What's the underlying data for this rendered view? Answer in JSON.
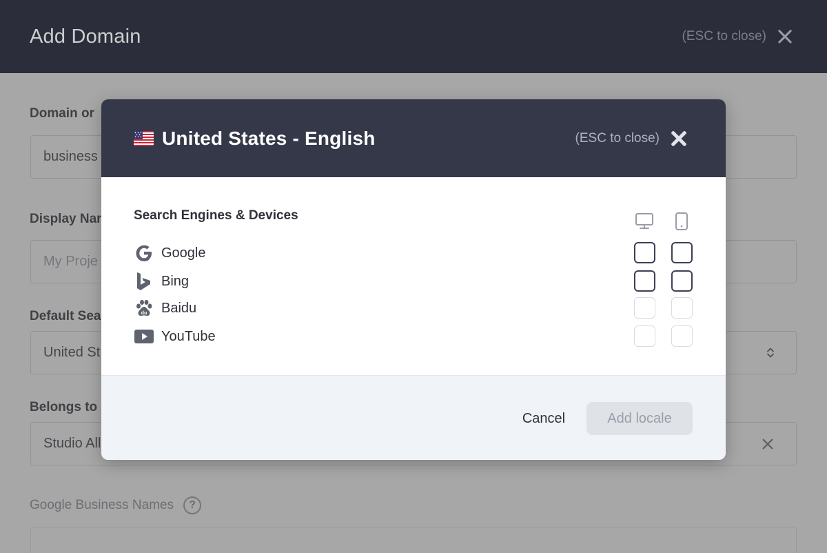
{
  "page": {
    "title": "Add Domain",
    "esc_hint": "(ESC to close)",
    "fields": {
      "domain_label": "Domain or",
      "domain_value": "business",
      "display_name_label": "Display Nar",
      "display_name_placeholder": "My Proje",
      "default_search_label": "Default Sea",
      "default_search_value": "United St",
      "belongs_to_label": "Belongs to",
      "belongs_to_value": "Studio All",
      "google_business_names_label": "Google Business Names",
      "help_glyph": "?"
    }
  },
  "modal": {
    "flag_icon": "us-flag-icon",
    "title": "United States - English",
    "esc_hint": "(ESC to close)",
    "section_title": "Search Engines & Devices",
    "devices": [
      "desktop-icon",
      "mobile-icon"
    ],
    "engines": [
      {
        "label": "Google",
        "icon": "google-icon",
        "enabled": true,
        "desktop": false,
        "mobile": false
      },
      {
        "label": "Bing",
        "icon": "bing-icon",
        "enabled": true,
        "desktop": false,
        "mobile": false
      },
      {
        "label": "Baidu",
        "icon": "baidu-icon",
        "enabled": false,
        "desktop": false,
        "mobile": false
      },
      {
        "label": "YouTube",
        "icon": "youtube-icon",
        "enabled": false,
        "desktop": false,
        "mobile": false
      }
    ],
    "buttons": {
      "cancel": "Cancel",
      "add_locale": "Add locale"
    }
  },
  "colors": {
    "header_bg": "#1e2233",
    "modal_header_bg": "#343849",
    "footer_bg": "#f0f3f7",
    "disabled_button_bg": "#dfe2e7"
  }
}
